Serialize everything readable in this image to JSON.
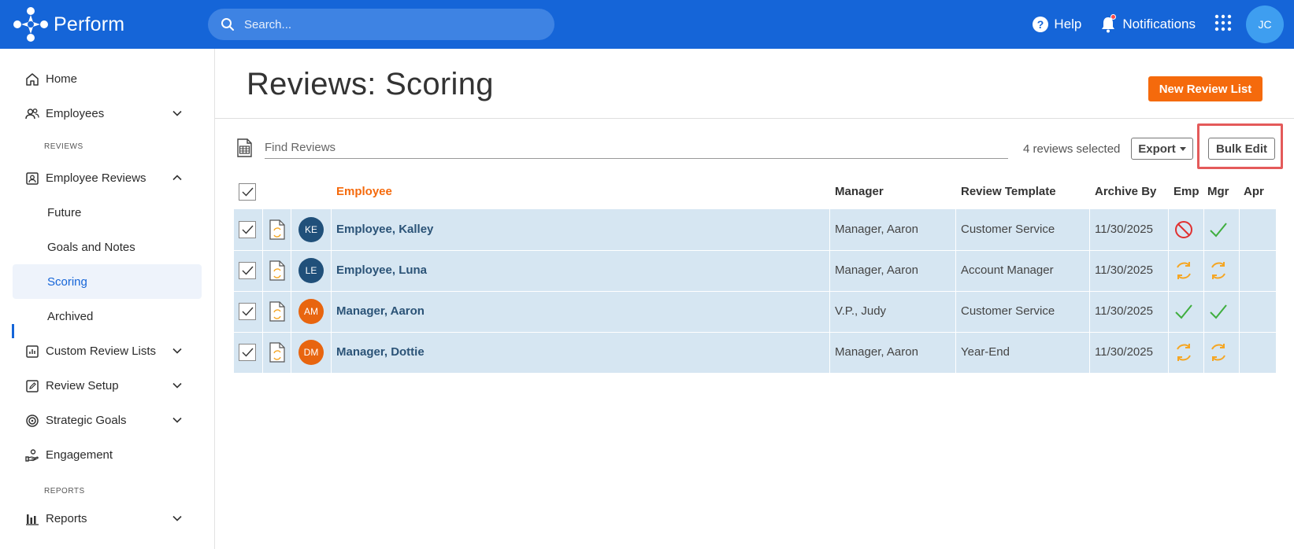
{
  "app": {
    "name": "Perform",
    "search_placeholder": "Search...",
    "help_label": "Help",
    "notifications_label": "Notifications",
    "user_initials": "JC",
    "colors": {
      "brand": "#1565d8",
      "accent": "#f56a0c",
      "row": "#d6e6f2"
    }
  },
  "sidebar": {
    "home": "Home",
    "employees": "Employees",
    "section_reviews": "REVIEWS",
    "employee_reviews": "Employee Reviews",
    "future": "Future",
    "goals_notes": "Goals and Notes",
    "scoring": "Scoring",
    "archived": "Archived",
    "custom_review_lists": "Custom Review Lists",
    "review_setup": "Review Setup",
    "strategic_goals": "Strategic Goals",
    "engagement": "Engagement",
    "section_reports": "REPORTS",
    "reports": "Reports"
  },
  "main": {
    "title": "Reviews: Scoring",
    "new_list_button": "New Review List",
    "find_placeholder": "Find Reviews",
    "selected_text": "4 reviews selected",
    "export_button": "Export",
    "bulk_edit_button": "Bulk Edit"
  },
  "table": {
    "headers": {
      "employee": "Employee",
      "manager": "Manager",
      "template": "Review Template",
      "archive_by": "Archive By",
      "emp": "Emp",
      "mgr": "Mgr",
      "apr": "Apr"
    },
    "rows": [
      {
        "initials": "KE",
        "avatar_color": "#20507a",
        "employee": "Employee, Kalley",
        "manager": "Manager, Aaron",
        "template": "Customer Service",
        "archive_by": "11/30/2025",
        "emp_status": "blocked-icon",
        "mgr_status": "check-icon"
      },
      {
        "initials": "LE",
        "avatar_color": "#20507a",
        "employee": "Employee, Luna",
        "manager": "Manager, Aaron",
        "template": "Account Manager",
        "archive_by": "11/30/2025",
        "emp_status": "in-progress-icon",
        "mgr_status": "in-progress-icon"
      },
      {
        "initials": "AM",
        "avatar_color": "#e8650f",
        "employee": "Manager, Aaron",
        "manager": "V.P., Judy",
        "template": "Customer Service",
        "archive_by": "11/30/2025",
        "emp_status": "check-icon",
        "mgr_status": "check-icon"
      },
      {
        "initials": "DM",
        "avatar_color": "#e8650f",
        "employee": "Manager, Dottie",
        "manager": "Manager, Aaron",
        "template": "Year-End",
        "archive_by": "11/30/2025",
        "emp_status": "in-progress-icon",
        "mgr_status": "in-progress-icon"
      }
    ]
  }
}
